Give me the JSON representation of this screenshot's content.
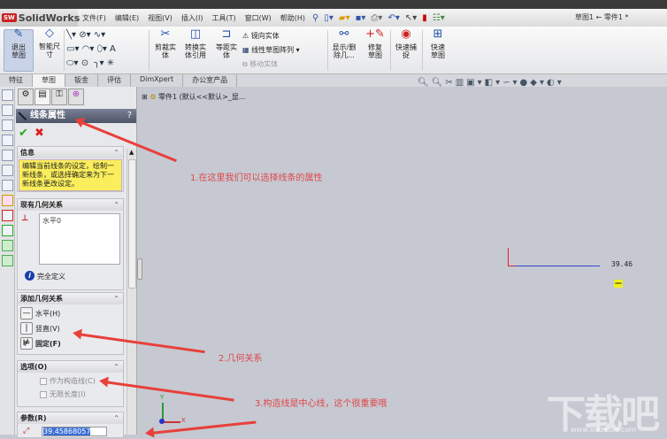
{
  "app": {
    "logo": "SolidWorks",
    "title": "草图1 ← 零件1 *"
  },
  "menu": [
    "文件(F)",
    "编辑(E)",
    "视图(V)",
    "插入(I)",
    "工具(T)",
    "窗口(W)",
    "帮助(H)"
  ],
  "ribbon": {
    "exit_sketch": "退出草图",
    "smart_dim": "智能尺寸",
    "trim": "剪裁实体",
    "convert": "转换实体引用",
    "offset": "等距实体",
    "mirror": "镜向实体",
    "linear_pattern": "线性草图阵列",
    "move": "移动实体",
    "show_delete": "显示/删除几...",
    "repair": "修复草图",
    "quick_snap": "快速捕捉",
    "rapid_sketch": "快速草图"
  },
  "tabs": [
    "特征",
    "草图",
    "钣金",
    "评估",
    "DimXpert",
    "办公室产品"
  ],
  "tree": {
    "root": "零件1 (默认<<默认>_显..."
  },
  "pm": {
    "title": "线条属性",
    "help": "?",
    "info": {
      "header": "信息",
      "text": "编辑当前线条的设定，绘制一新线条，或选择确定来为下一新线条更改设定。"
    },
    "existing": {
      "header": "现有几何关系",
      "items": [
        "水平0"
      ],
      "status": "完全定义"
    },
    "add": {
      "header": "添加几何关系",
      "items": [
        "水平(H)",
        "竖直(V)",
        "固定(F)"
      ]
    },
    "options": {
      "header": "选项(O)",
      "items": [
        "作为构造线(C)",
        "无限长度(I)"
      ]
    },
    "params": {
      "header": "参数(R)",
      "length": "39.45868057"
    }
  },
  "canvas": {
    "dimension": "39.46",
    "axis_x": "X",
    "axis_y": "Y"
  },
  "annotations": [
    "1.在这里我们可以选择线条的属性",
    "2.几何关系",
    "3.构造线是中心线，这个很重要哦"
  ],
  "watermark": {
    "text": "下载吧",
    "url": "www.xiazaiba.com"
  }
}
